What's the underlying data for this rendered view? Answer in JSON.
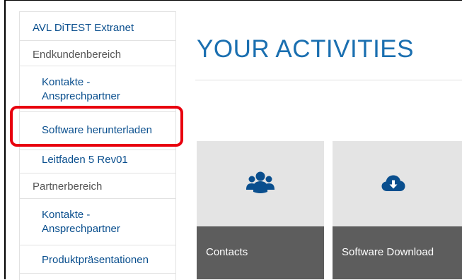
{
  "sidebar": {
    "items": [
      {
        "label": "AVL DiTEST Extranet"
      },
      {
        "label": "Endkundenbereich"
      },
      {
        "label": "Kontakte - Ansprechpartner"
      },
      {
        "label": "Software herunterladen"
      },
      {
        "label": "Leitfaden 5 Rev01"
      },
      {
        "label": "Partnerbereich"
      },
      {
        "label": "Kontakte - Ansprechpartner"
      },
      {
        "label": "Produktpräsentationen"
      }
    ]
  },
  "main": {
    "title": "YOUR ACTIVITIES",
    "tiles": [
      {
        "label": "Contacts",
        "icon": "users-icon"
      },
      {
        "label": "Software Download",
        "icon": "cloud-download-icon"
      }
    ]
  },
  "colors": {
    "link": "#0a4f8e",
    "title": "#1a6fb0",
    "highlight": "#e8000e",
    "tile_bg": "#e4e4e4",
    "tile_footer": "#5d5d5d"
  }
}
